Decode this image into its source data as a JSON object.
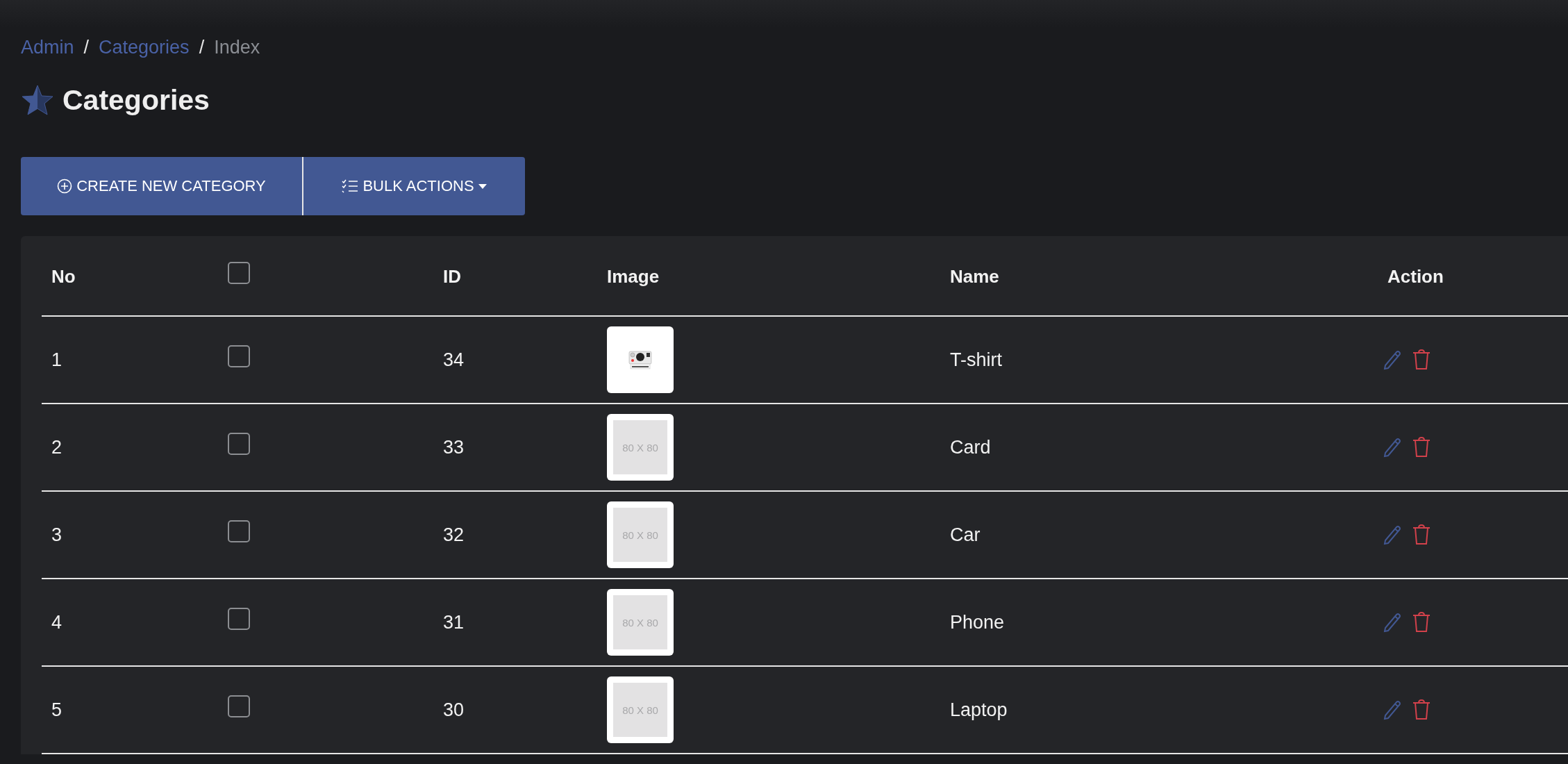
{
  "breadcrumb": [
    {
      "label": "Admin",
      "kind": "link"
    },
    {
      "label": "Categories",
      "kind": "link"
    },
    {
      "label": "Index",
      "kind": "current"
    }
  ],
  "breadcrumb_separator": "/",
  "page_title": "Categories",
  "toolbar": {
    "create_button": "CREATE NEW CATEGORY",
    "bulk_button": "BULK ACTIONS"
  },
  "table": {
    "columns": [
      "No",
      "",
      "ID",
      "Image",
      "Name",
      "Action"
    ],
    "header_checkbox": {
      "checked": false
    },
    "rows": [
      {
        "no": "1",
        "checked": false,
        "id": "34",
        "image": {
          "kind": "photo"
        },
        "name": "T-shirt"
      },
      {
        "no": "2",
        "checked": false,
        "id": "33",
        "image": {
          "kind": "placeholder",
          "label": "80 X 80"
        },
        "name": "Card"
      },
      {
        "no": "3",
        "checked": false,
        "id": "32",
        "image": {
          "kind": "placeholder",
          "label": "80 X 80"
        },
        "name": "Car"
      },
      {
        "no": "4",
        "checked": false,
        "id": "31",
        "image": {
          "kind": "placeholder",
          "label": "80 X 80"
        },
        "name": "Phone"
      },
      {
        "no": "5",
        "checked": false,
        "id": "30",
        "image": {
          "kind": "placeholder",
          "label": "80 X 80"
        },
        "name": "Laptop"
      }
    ]
  }
}
